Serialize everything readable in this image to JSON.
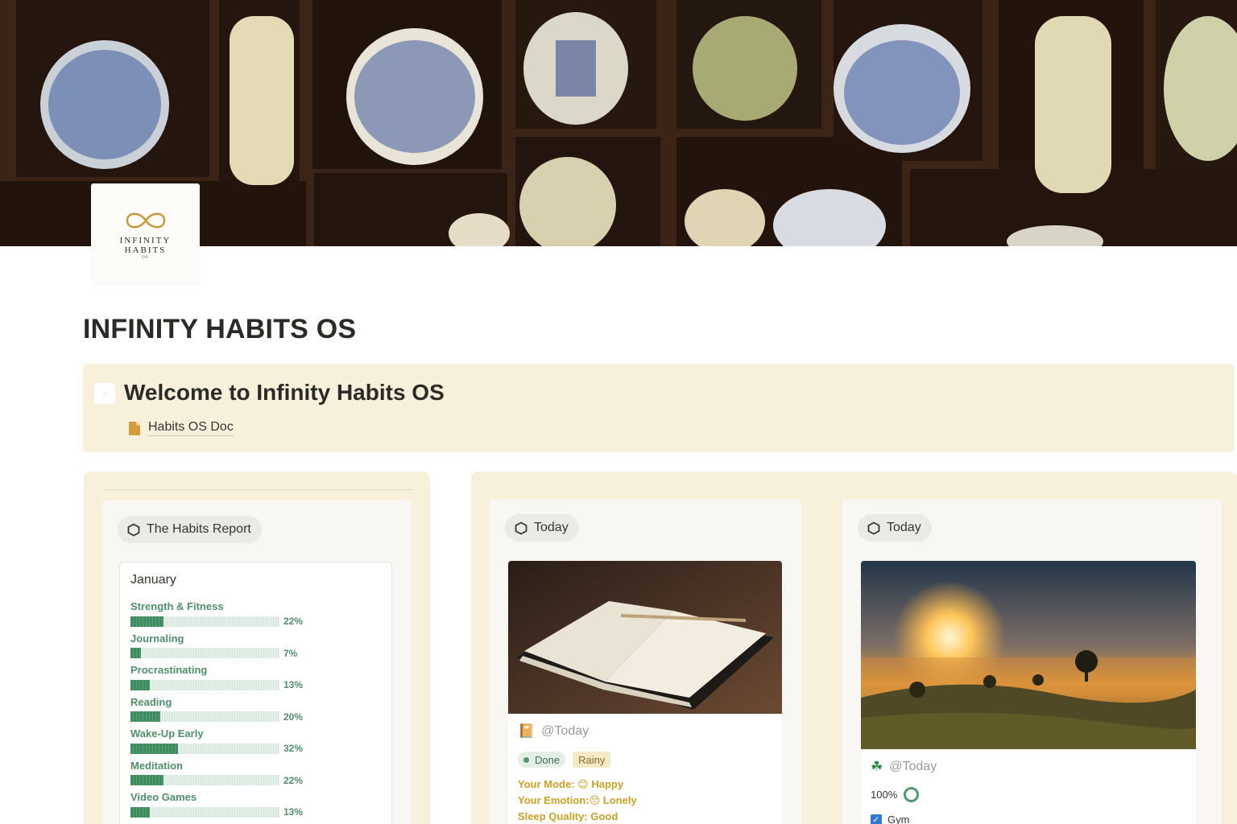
{
  "cover": {
    "image": "shelves-of-porcelain-jars-photo"
  },
  "logo": {
    "line1": "INFINITY",
    "line2": "HABITS",
    "line3": "OS",
    "icon": "infinity-loop-icon"
  },
  "page": {
    "title": "INFINITY HABITS OS"
  },
  "welcome": {
    "icon": "page-emoji-icon",
    "title": "Welcome to Infinity Habits OS",
    "doc_link": {
      "icon": "document-icon",
      "label": "Habits OS Doc"
    }
  },
  "report": {
    "pill_label": "The Habits Report",
    "pill_icon": "hexagon-icon",
    "month": "January",
    "bar_color": "#3f8a5e",
    "habits": [
      {
        "name": "Strength & Fitness",
        "value": 0.22,
        "label": "22%"
      },
      {
        "name": "Journaling",
        "value": 0.07,
        "label": "7%"
      },
      {
        "name": "Procrastinating",
        "value": 0.13,
        "label": "13%"
      },
      {
        "name": "Reading",
        "value": 0.2,
        "label": "20%"
      },
      {
        "name": "Wake-Up Early",
        "value": 0.32,
        "label": "32%"
      },
      {
        "name": "Meditation",
        "value": 0.22,
        "label": "22%"
      },
      {
        "name": "Video Games",
        "value": 0.13,
        "label": "13%"
      }
    ]
  },
  "journal_card": {
    "pill_label": "Today",
    "pill_icon": "hexagon-icon",
    "image": "open-notebook-with-pencil-photo",
    "entry_icon": "journal-emoji-icon",
    "date": "@Today",
    "status": "Done",
    "weather": "Rainy",
    "mode_label": "Your Mode:",
    "mode_emoji": "😊",
    "mode_value": "Happy",
    "emotion_label": "Your Emotion:",
    "emotion_emoji": "😔",
    "emotion_value": "Lonely",
    "sleep_label": "Sleep Quality:",
    "sleep_value": "Good"
  },
  "habit_card": {
    "pill_label": "Today",
    "pill_icon": "hexagon-icon",
    "image": "sunrise-over-misty-field-photo",
    "entry_icon": "four-leaf-clover-icon",
    "date": "@Today",
    "progress_label": "100%",
    "progress_value": 1.0,
    "check_label": "Gym",
    "check_checked": true
  }
}
